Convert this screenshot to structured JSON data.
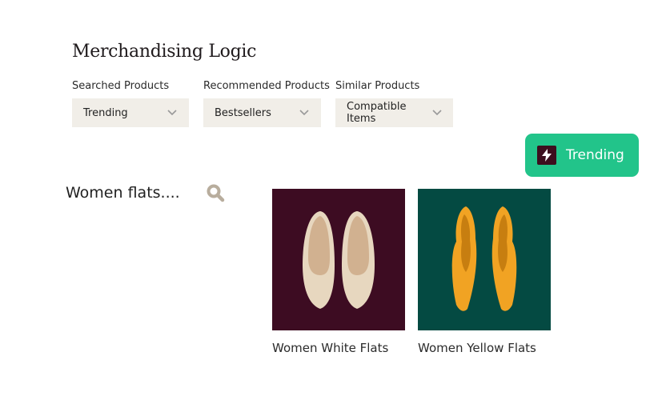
{
  "title": "Merchandising Logic",
  "dropdowns": [
    {
      "label": "Searched Products",
      "value": "Trending"
    },
    {
      "label": "Recommended Products",
      "value": "Bestsellers"
    },
    {
      "label": "Similar Products",
      "value": "Compatible Items"
    }
  ],
  "badge": {
    "label": "Trending",
    "icon": "lightning-bolt-icon",
    "color": "#22c48a",
    "icon_bg": "#3d0e1e"
  },
  "search": {
    "query": "Women flats....",
    "icon": "search-icon"
  },
  "products": [
    {
      "name": "Women White Flats",
      "background": "#3d0c22",
      "shoe_color": "#e7d7bf"
    },
    {
      "name": "Women Yellow Flats",
      "background": "#044a42",
      "shoe_color": "#f1a323"
    }
  ]
}
